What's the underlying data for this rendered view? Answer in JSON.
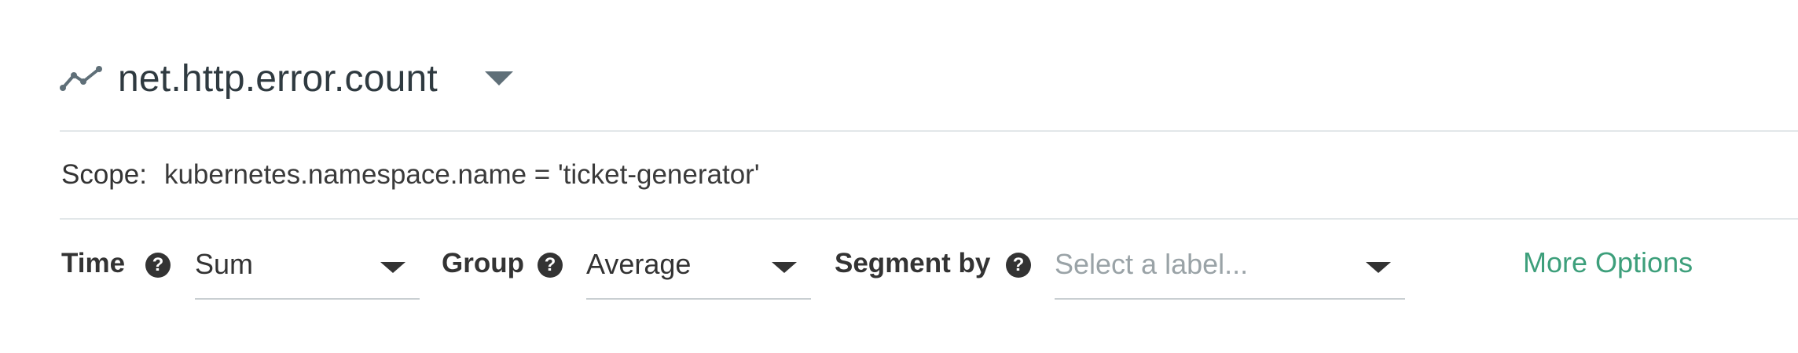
{
  "metric": {
    "icon": "line-chart-icon",
    "title": "net.http.error.count",
    "dropdown_icon": "caret-down-icon"
  },
  "scope": {
    "label": "Scope:",
    "value": "kubernetes.namespace.name = 'ticket-generator'"
  },
  "options": {
    "time": {
      "label": "Time",
      "help_icon": "help-icon",
      "value": "Sum"
    },
    "group": {
      "label": "Group",
      "help_icon": "help-icon",
      "value": "Average"
    },
    "segment": {
      "label": "Segment by",
      "help_icon": "help-icon",
      "placeholder": "Select a label..."
    },
    "more_options": "More Options"
  },
  "colors": {
    "accent": "#3d9f7b",
    "icon": "#5f6f78",
    "divider": "#e2e7e9"
  }
}
